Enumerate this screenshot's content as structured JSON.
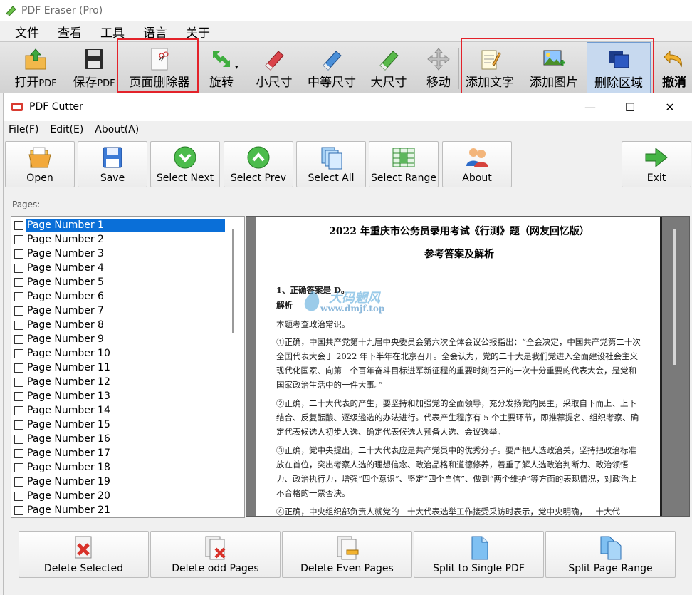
{
  "outer": {
    "title": "PDF Eraser (Pro)",
    "menu": [
      "文件",
      "查看",
      "工具",
      "语言",
      "关于"
    ],
    "toolbar": {
      "open": "打开",
      "open_suffix": "PDF",
      "save": "保存",
      "save_suffix": "PDF",
      "page_deleter": "页面删除器",
      "rotate": "旋转",
      "small": "小尺寸",
      "medium": "中等尺寸",
      "large": "大尺寸",
      "move": "移动",
      "add_text": "添加文字",
      "add_image": "添加图片",
      "delete_area": "删除区域",
      "undo": "撤消"
    }
  },
  "inner": {
    "title": "PDF Cutter",
    "window_controls": {
      "minimize": "—",
      "maximize": "☐",
      "close": "✕"
    },
    "menu": [
      "File(F)",
      "Edit(E)",
      "About(A)"
    ],
    "toolbar": {
      "open": "Open",
      "save": "Save",
      "select_next": "Select Next",
      "select_prev": "Select Prev",
      "select_all": "Select All",
      "select_range": "Select Range",
      "about": "About",
      "exit": "Exit"
    },
    "pages_label": "Pages:",
    "pages": [
      "Page Number 1",
      "Page Number 2",
      "Page Number 3",
      "Page Number 4",
      "Page Number 5",
      "Page Number 6",
      "Page Number 7",
      "Page Number 8",
      "Page Number 9",
      "Page Number 10",
      "Page Number 11",
      "Page Number 12",
      "Page Number 13",
      "Page Number 14",
      "Page Number 15",
      "Page Number 16",
      "Page Number 17",
      "Page Number 18",
      "Page Number 19",
      "Page Number 20",
      "Page Number 21"
    ],
    "selected_page_index": 0,
    "document": {
      "title": "2022 年重庆市公务员录用考试《行测》题（网友回忆版）",
      "subtitle": "参考答案及解析",
      "q1": "1、正确答案是 D。",
      "analysis": "解析",
      "intro": "本题考查政治常识。",
      "p1": "①正确，中国共产党第十九届中央委员会第六次全体会议公报指出：“全会决定，中国共产党第二十次全国代表大会于 2022 年下半年在北京召开。全会认为，党的二十大是我们党进入全面建设社会主义现代化国家、向第二个百年奋斗目标进军新征程的重要时刻召开的一次十分重要的代表大会，是党和国家政治生活中的一件大事。”",
      "p2": "②正确，二十大代表的产生，要坚持和加强党的全面领导，充分发扬党内民主，采取自下而上、上下结合、反复酝酿、逐级遴选的办法进行。代表产生程序有 5 个主要环节，即推荐提名、组织考察、确定代表候选人初步人选、确定代表候选人预备人选、会议选举。",
      "p3": "③正确，党中央提出，二十大代表应是共产党员中的优秀分子。要严把人选政治关，坚持把政治标准放在首位，突出考察人选的理想信念、政治品格和道德修养，着重了解人选政治判断力、政治领悟力、政治执行力，增强“四个意识”、坚定“四个自信”、做到“两个维护”等方面的表现情况，对政治上不合格的一票否决。",
      "p4": "④正确，中央组织部负责人就党的二十大代表选举工作接受采访时表示，党中央明确，二十大代"
    },
    "watermark": {
      "name": "大码魍风",
      "url": "www.dmjf.top"
    },
    "bottom": {
      "delete_selected": "Delete Selected",
      "delete_odd": "Delete odd Pages",
      "delete_even": "Delete Even Pages",
      "split_single": "Split to Single PDF",
      "split_range": "Split Page Range"
    }
  },
  "colors": {
    "highlight_box": "#e3222a",
    "selected_item": "#0a6fd8",
    "active_tool": "#c7d9ef"
  }
}
